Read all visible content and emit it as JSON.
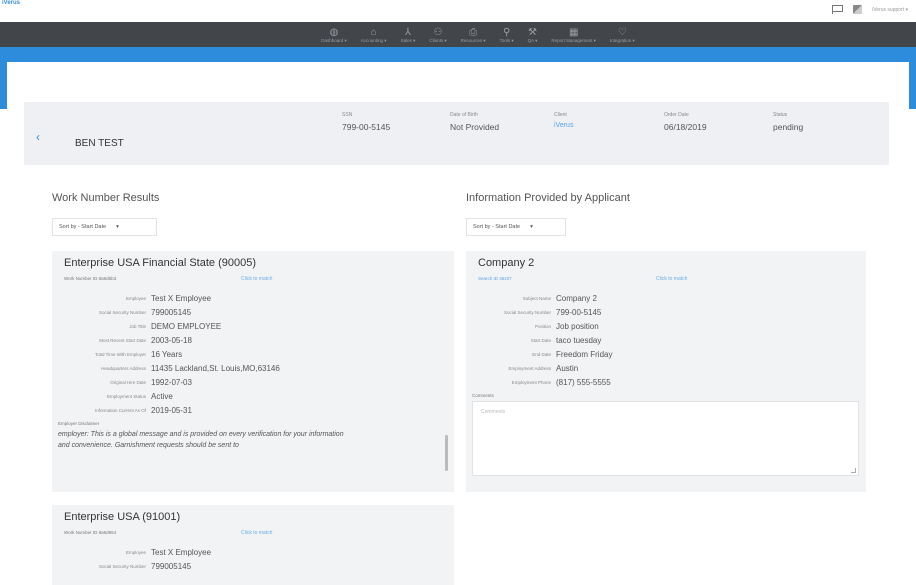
{
  "top": {
    "logo": "iVerus",
    "user_label": "iVerus support",
    "user_caret": "▾"
  },
  "nav": {
    "items": [
      {
        "icon": "◍",
        "label": "Dashboard ▾"
      },
      {
        "icon": "⌂",
        "label": "Accounting ▾"
      },
      {
        "icon": "⅄",
        "label": "Sales ▾"
      },
      {
        "icon": "⚇",
        "label": "Clients ▾"
      },
      {
        "icon": "⎙",
        "label": "Resources ▾"
      },
      {
        "icon": "⚲",
        "label": "Tools ▾"
      },
      {
        "icon": "⚒",
        "label": "QA ▾"
      },
      {
        "icon": "▦",
        "label": "Report Management ▾"
      },
      {
        "icon": "♡",
        "label": "Integration ▾"
      }
    ]
  },
  "header": {
    "back": "‹",
    "name": "BEN TEST",
    "ssn_label": "SSN",
    "ssn": "799-00-5145",
    "dob_label": "Date of Birth",
    "dob": "Not Provided",
    "client_label": "Client",
    "client": "iVerus",
    "order_date_label": "Order Date",
    "order_date": "06/18/2019",
    "status_label": "Status",
    "status": "pending"
  },
  "left": {
    "title": "Work Number Results",
    "sort": "Sort by - Start Date",
    "caret": "▾",
    "card1": {
      "title": "Enterprise USA Financial State (90005)",
      "sub": "Work Number ID 8a9d5b3",
      "match": "Click to match",
      "fields": [
        {
          "label": "Employee",
          "value": "Test X Employee"
        },
        {
          "label": "Social Security Number",
          "value": "799005145"
        },
        {
          "label": "Job Title",
          "value": "DEMO EMPLOYEE"
        },
        {
          "label": "Most Recent Start Date",
          "value": "2003-05-18"
        },
        {
          "label": "Total Time With Employer",
          "value": "16 Years"
        },
        {
          "label": "Headquarters Address",
          "value": "11435 Lackland,St. Louis,MO,63146"
        },
        {
          "label": "Original Hire Date",
          "value": "1992-07-03"
        },
        {
          "label": "Employment Status",
          "value": "Active"
        },
        {
          "label": "Information Current As Of",
          "value": "2019-05-31"
        }
      ],
      "disclaimer_label": "Employer Disclaimer",
      "disclaimer_line1": "employer: This is a global message and is provided on every verification for your information",
      "disclaimer_line2": "and convenience. Garnishment requests should be sent to"
    },
    "card2": {
      "title": "Enterprise USA (91001)",
      "sub": "Work Number ID 8a9d964",
      "match": "Click to match",
      "fields": [
        {
          "label": "Employee",
          "value": "Test X Employee"
        },
        {
          "label": "Social Security Number",
          "value": "799005145"
        }
      ]
    }
  },
  "right": {
    "title": "Information Provided by Applicant",
    "sort": "Sort by - Start Date",
    "caret": "▾",
    "card": {
      "title": "Company 2",
      "sub": "Search ID 36107",
      "match": "Click to match",
      "fields": [
        {
          "label": "Subject Name",
          "value": "Company 2"
        },
        {
          "label": "Social Security Number",
          "value": "799-00-5145"
        },
        {
          "label": "Position",
          "value": "Job position"
        },
        {
          "label": "Start Date",
          "value": "taco tuesday"
        },
        {
          "label": "End Date",
          "value": "Freedom Friday"
        },
        {
          "label": "Employment Address",
          "value": "Austin"
        },
        {
          "label": "Employment Phone",
          "value": "(817) 555-5555"
        }
      ],
      "comments_label": "Comments",
      "comments_placeholder": "Comments"
    }
  }
}
